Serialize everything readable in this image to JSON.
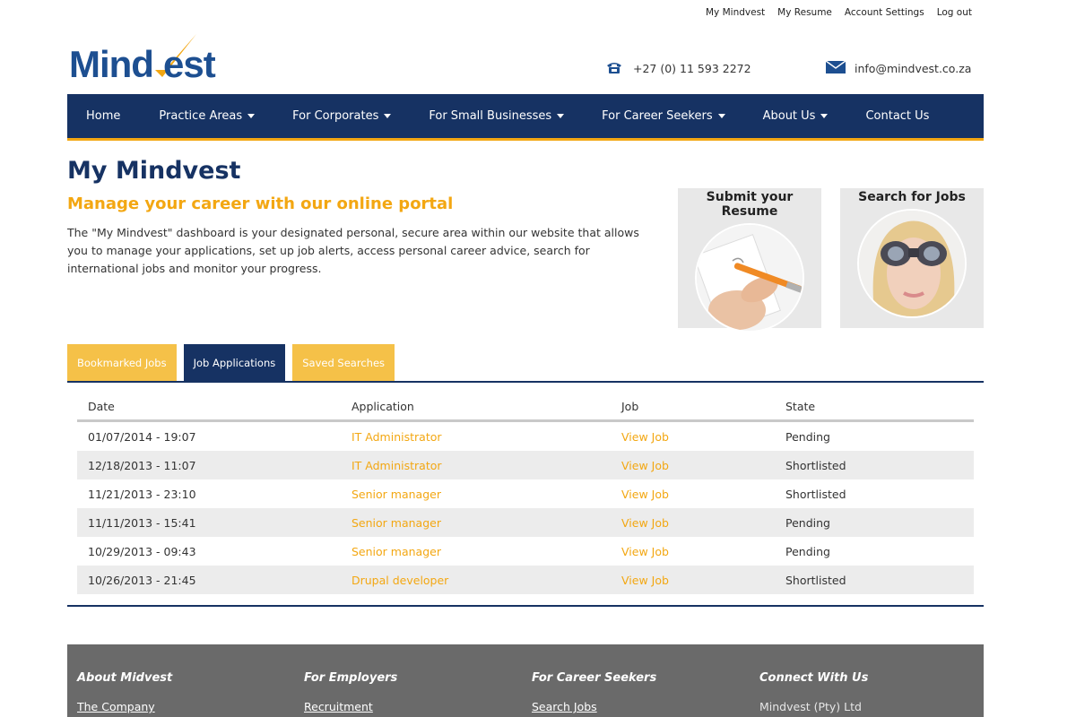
{
  "top_links": [
    "My Mindvest",
    "My Resume",
    "Account Settings",
    "Log out"
  ],
  "brand": {
    "name": "Mindvest",
    "navy": "#163263",
    "accent": "#f3a712"
  },
  "header": {
    "phone": "+27 (0) 11 593 2272",
    "email": "info@mindvest.co.za",
    "phone_icon": "phone-icon",
    "mail_icon": "envelope-icon"
  },
  "nav": {
    "items": [
      {
        "label": "Home",
        "dropdown": false
      },
      {
        "label": "Practice Areas",
        "dropdown": true
      },
      {
        "label": "For Corporates",
        "dropdown": true
      },
      {
        "label": "For Small Businesses",
        "dropdown": true
      },
      {
        "label": "For Career Seekers",
        "dropdown": true
      },
      {
        "label": "About Us",
        "dropdown": true
      },
      {
        "label": "Contact Us",
        "dropdown": false
      }
    ]
  },
  "page": {
    "title": "My Mindvest",
    "subtitle": "Manage your career with our online portal",
    "intro": "The \"My Mindvest\" dashboard is your designated personal, secure area within our website that allows you to manage your applications, set up job alerts, access personal career advice, search for international jobs and monitor your progress."
  },
  "promos": [
    {
      "title": "Submit your Resume"
    },
    {
      "title": "Search for Jobs"
    }
  ],
  "tabs": [
    {
      "label": "Bookmarked Jobs",
      "active": false
    },
    {
      "label": "Job Applications",
      "active": true
    },
    {
      "label": "Saved Searches",
      "active": false
    }
  ],
  "table": {
    "headers": [
      "Date",
      "Application",
      "Job",
      "State"
    ],
    "rows": [
      {
        "date": "01/07/2014 - 19:07",
        "application": "IT Administrator",
        "job": "View Job",
        "state": "Pending"
      },
      {
        "date": "12/18/2013 - 11:07",
        "application": "IT Administrator",
        "job": "View Job",
        "state": "Shortlisted"
      },
      {
        "date": "11/21/2013 - 23:10",
        "application": "Senior manager",
        "job": "View Job",
        "state": "Shortlisted"
      },
      {
        "date": "11/11/2013 - 15:41",
        "application": "Senior manager",
        "job": "View Job",
        "state": "Pending"
      },
      {
        "date": "10/29/2013 - 09:43",
        "application": "Senior manager",
        "job": "View Job",
        "state": "Pending"
      },
      {
        "date": "10/26/2013 - 21:45",
        "application": "Drupal developer",
        "job": "View Job",
        "state": "Shortlisted"
      }
    ]
  },
  "footer": {
    "cols": [
      {
        "heading": "About Midvest",
        "item": "The Company",
        "is_link": true
      },
      {
        "heading": "For Employers",
        "item": "Recruitment",
        "is_link": true
      },
      {
        "heading": "For Career Seekers",
        "item": "Search Jobs",
        "is_link": true
      },
      {
        "heading": "Connect With Us",
        "item": "Mindvest (Pty) Ltd",
        "is_link": false
      }
    ]
  }
}
